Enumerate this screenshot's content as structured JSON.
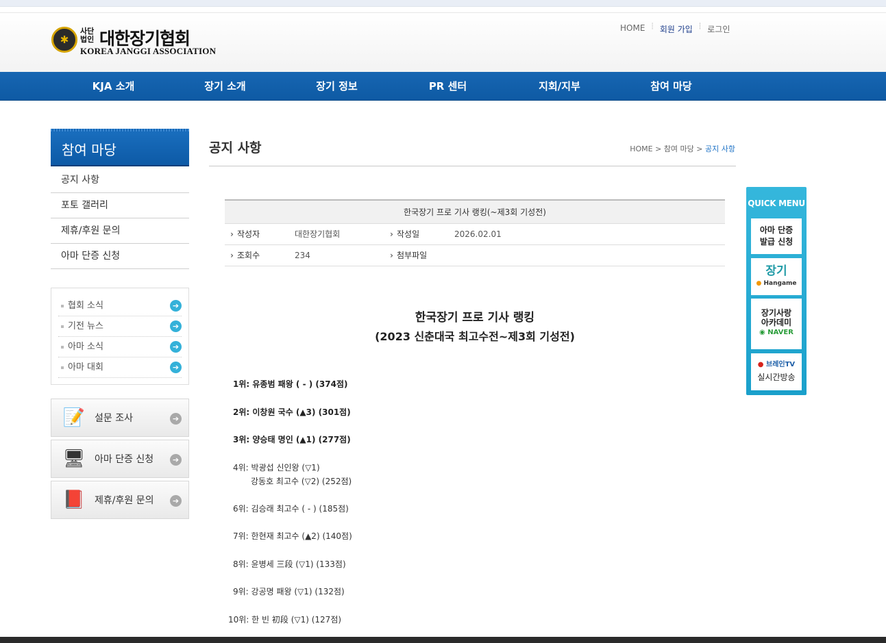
{
  "header": {
    "logo_small": "사단법인",
    "logo_main": "대한장기협회",
    "logo_eng": "KOREA JANGGI ASSOCIATION",
    "util_links": [
      "HOME",
      "회원 가입",
      "로그인"
    ]
  },
  "gnb": [
    "KJA 소개",
    "장기 소개",
    "장기 정보",
    "PR 센터",
    "지회/지부",
    "참여 마당"
  ],
  "sidebar": {
    "title": "참여 마당",
    "items": [
      "공지 사항",
      "포토 갤러리",
      "제휴/후원 문의",
      "아마 단증 신청"
    ],
    "news": [
      "협회 소식",
      "기전 뉴스",
      "아마 소식",
      "아마 대회"
    ],
    "banners": [
      "설문 조사",
      "아마 단증 신청",
      "제휴/후원 문의"
    ]
  },
  "page": {
    "title": "공지 사항",
    "breadcrumb": [
      "HOME",
      "참여 마당",
      "공지 사항"
    ]
  },
  "board": {
    "subject": "한국장기 프로 기사 랭킹(~제3회 기성전)",
    "author_label": "작성자",
    "author": "대한장기협회",
    "date_label": "작성일",
    "date": "2026.02.01",
    "views_label": "조회수",
    "views": "234",
    "file_label": "첨부파일"
  },
  "article": {
    "title": "한국장기 프로 기사 랭킹",
    "subtitle": "(2023 신춘대국 최고수전~제3회 기성전)",
    "rankings": [
      "1위: 유종범 패왕 ( - ) (374점)",
      "2위: 이창원 국수 (▲3) (301점)",
      "3위: 양승태 명인 (▲1) (277점)",
      "4위: 박광섭 신인왕 (▽1)",
      "강동호 최고수 (▽2) (252점)",
      "6위: 김승래 최고수 ( - ) (185점)",
      "7위: 한현재 최고수 (▲2) (140점)",
      "8위: 윤병세 三段 (▽1) (133점)",
      "9위: 강공명 패왕 (▽1) (132점)",
      "10위: 한 빈 初段 (▽1) (127점)"
    ]
  },
  "quick": {
    "title": "QUICK MENU",
    "items": [
      {
        "l1": "아마 단증",
        "l2": "발급 신청"
      },
      {
        "l1": "장기",
        "l2": "Hangame"
      },
      {
        "l1": "장기사랑",
        "l2": "아카데미",
        "l3": "NAVER"
      },
      {
        "l1": "브레인TV",
        "l2": "실시간방송"
      }
    ]
  }
}
